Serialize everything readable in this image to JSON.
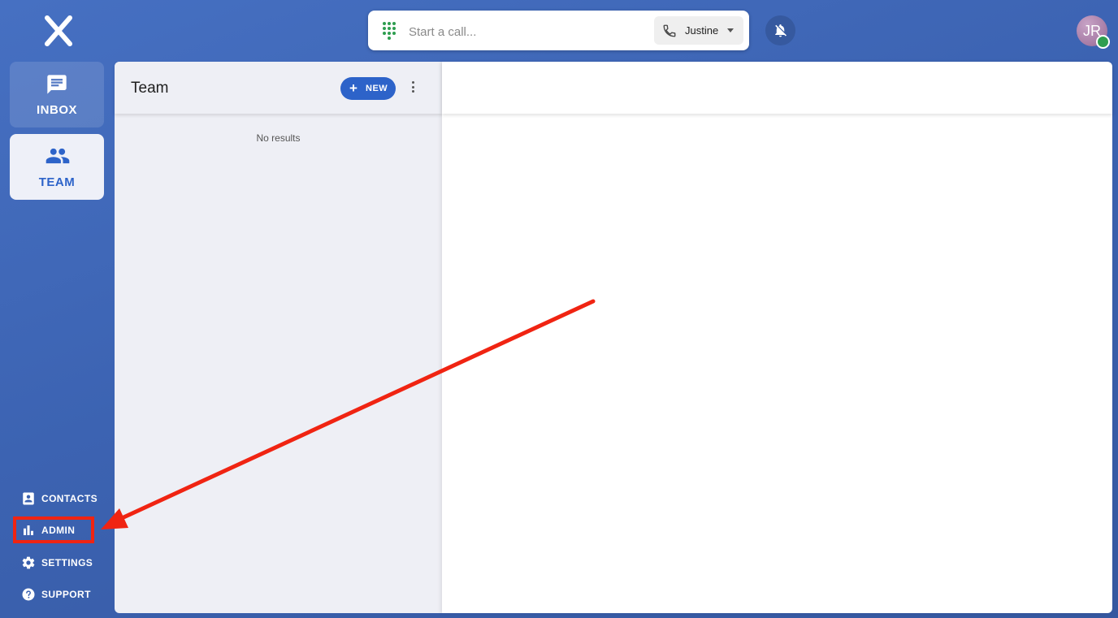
{
  "brand": {
    "logo_icon": "x-logo-icon"
  },
  "topbar": {
    "call_placeholder": "Start a call...",
    "caller_name": "Justine",
    "avatar_initials": "JR",
    "status_color": "#2e9d4f"
  },
  "sidebar": {
    "tiles": [
      {
        "label": "INBOX",
        "icon": "chat-icon"
      },
      {
        "label": "TEAM",
        "icon": "people-icon"
      }
    ],
    "links": [
      {
        "label": "CONTACTS",
        "icon": "contact-card-icon"
      },
      {
        "label": "ADMIN",
        "icon": "bar-chart-icon"
      },
      {
        "label": "SETTINGS",
        "icon": "gear-icon"
      },
      {
        "label": "SUPPORT",
        "icon": "help-icon"
      }
    ]
  },
  "list_panel": {
    "title": "Team",
    "new_label": "NEW",
    "empty_text": "No results"
  },
  "colors": {
    "accent": "#2d63c9",
    "annotation": "#f02412"
  }
}
